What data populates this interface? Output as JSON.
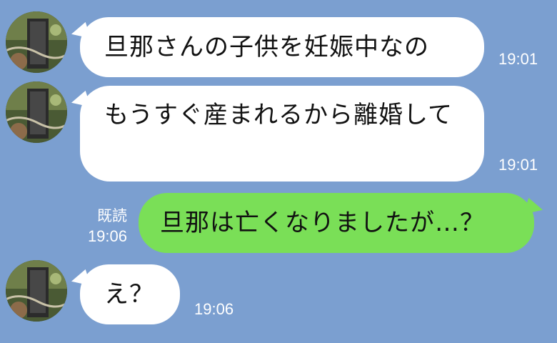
{
  "messages": [
    {
      "side": "in",
      "text": "旦那さんの子供を妊娠中なの",
      "time": "19:01",
      "avatar": "sender-avatar"
    },
    {
      "side": "in",
      "text": "もうすぐ産まれるから離婚して",
      "time": "19:01",
      "avatar": "sender-avatar"
    },
    {
      "side": "out",
      "text": "旦那は亡くなりましたが…？",
      "time": "19:06",
      "read_label": "既読"
    },
    {
      "side": "in",
      "text": "え？",
      "time": "19:06",
      "avatar": "sender-avatar"
    }
  ],
  "colors": {
    "background": "#7b9fd0",
    "incoming_bubble": "#ffffff",
    "outgoing_bubble": "#7adf57",
    "timestamp": "#ffffff"
  }
}
